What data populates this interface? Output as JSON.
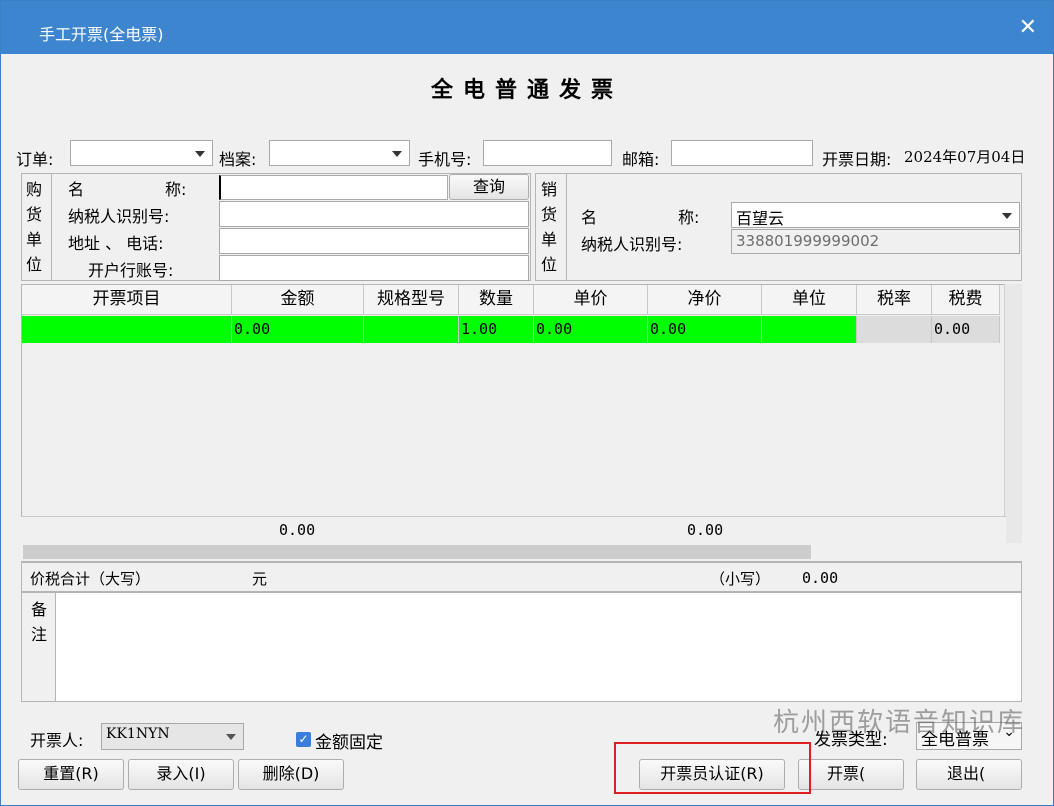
{
  "window": {
    "title": "手工开票(全电票)",
    "close": "✕"
  },
  "heading": "全电普通发票",
  "filters": {
    "order_label": "订单:",
    "order_value": "",
    "archive_label": "档案:",
    "archive_value": "",
    "phone_label": "手机号:",
    "phone_value": "",
    "email_label": "邮箱:",
    "email_value": "",
    "date_label": "开票日期:",
    "date_value": "2024年07月04日"
  },
  "buyer": {
    "side_chars": [
      "购",
      "货",
      "单",
      "位"
    ],
    "name_label_a": "名",
    "name_label_b": "称:",
    "tax_label": "纳税人识别号:",
    "addr_label": "地址 、 电话:",
    "bank_label": "开户行账号:",
    "name_value": "",
    "tax_value": "",
    "addr_value": "",
    "bank_value": "",
    "query_button": "查询"
  },
  "seller": {
    "side_chars": [
      "销",
      "货",
      "单",
      "位"
    ],
    "name_label_a": "名",
    "name_label_b": "称:",
    "tax_label": "纳税人识别号:",
    "name_value": "百望云",
    "tax_value": "338801999999002"
  },
  "grid": {
    "columns": [
      "开票项目",
      "金额",
      "规格型号",
      "数量",
      "单价",
      "净价",
      "单位",
      "税率",
      "税费"
    ],
    "row": [
      "",
      "0.00",
      "",
      "1.00",
      "0.00",
      "0.00",
      "",
      "",
      "0.00"
    ],
    "sum_amount": "0.00",
    "sum_net": "0.00"
  },
  "totals": {
    "upper_label": "价税合计（大写）",
    "upper_value": "元",
    "lower_label": "（小写）",
    "lower_value": "0.00"
  },
  "remarks": {
    "side_chars": [
      "备",
      "注"
    ],
    "value": ""
  },
  "footer": {
    "issuer_label": "开票人:",
    "issuer_value": "KK1NYN",
    "fixed_amount_label": "金额固定",
    "fixed_amount_checked": true,
    "invoice_type_label": "发票类型:",
    "invoice_type_value": "全电普票",
    "reset_button": "重置(R)",
    "enter_button": "录入(I)",
    "delete_button": "删除(D)",
    "auth_button": "开票员认证(R)",
    "issue_button": "开票(",
    "exit_button": "退出("
  },
  "watermark": "杭州西软语音知识库",
  "colors": {
    "titlebar": "#3d86cf",
    "row_highlight": "#00ff00",
    "annotation": "#e02020"
  }
}
